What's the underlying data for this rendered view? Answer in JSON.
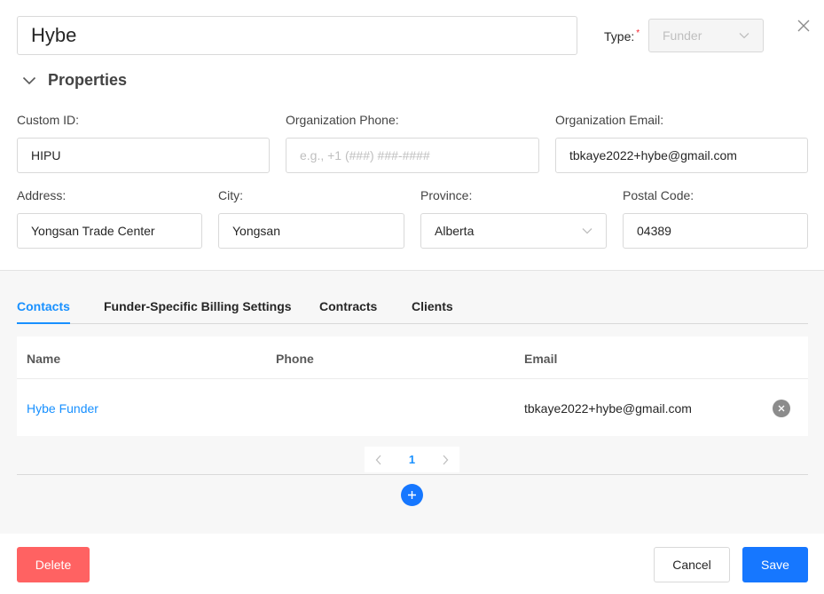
{
  "header": {
    "name_value": "Hybe",
    "type_label": "Type:",
    "required_mark": "*",
    "type_value": "Funder",
    "icons": {
      "close": "close-icon",
      "type_dropdown": "chevron-down-icon"
    }
  },
  "properties": {
    "title": "Properties",
    "icon": "chevron-down-icon",
    "custom_id": {
      "label": "Custom ID:",
      "value": "HIPU"
    },
    "org_phone": {
      "label": "Organization Phone:",
      "value": "",
      "placeholder": "e.g., +1 (###) ###-####"
    },
    "org_email": {
      "label": "Organization Email:",
      "value": "tbkaye2022+hybe@gmail.com"
    },
    "address": {
      "label": "Address:",
      "value": "Yongsan Trade Center"
    },
    "city": {
      "label": "City:",
      "value": "Yongsan"
    },
    "province": {
      "label": "Province:",
      "value": "Alberta"
    },
    "postal_code": {
      "label": "Postal Code:",
      "value": "04389"
    }
  },
  "tabs": [
    {
      "label": "Contacts",
      "active": true
    },
    {
      "label": "Funder-Specific Billing Settings",
      "active": false
    },
    {
      "label": "Contracts",
      "active": false
    },
    {
      "label": "Clients",
      "active": false
    }
  ],
  "contacts_table": {
    "columns": [
      "Name",
      "Phone",
      "Email"
    ],
    "rows": [
      {
        "name": "Hybe Funder",
        "phone": "",
        "email": "tbkaye2022+hybe@gmail.com"
      }
    ]
  },
  "pagination": {
    "current_page": "1"
  },
  "footer": {
    "delete_label": "Delete",
    "cancel_label": "Cancel",
    "save_label": "Save"
  },
  "colors": {
    "accent": "#1890ff",
    "primary_button": "#1677ff",
    "danger_button": "#ff6262"
  }
}
